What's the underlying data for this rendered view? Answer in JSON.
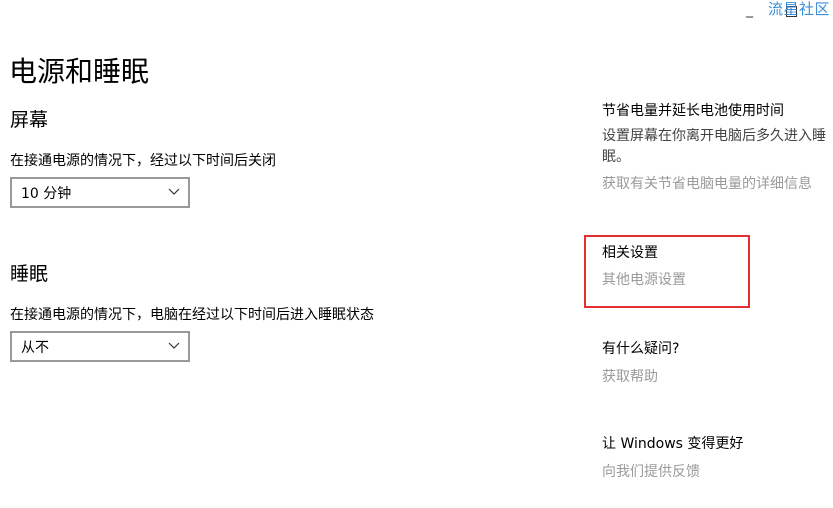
{
  "watermark": "流星社区",
  "window": {
    "minimize_icon": "minimize-icon",
    "maximize_icon": "maximize-icon"
  },
  "page": {
    "title": "电源和睡眠"
  },
  "screen": {
    "title": "屏幕",
    "label": "在接通电源的情况下，经过以下时间后关闭",
    "value": "10 分钟"
  },
  "sleep": {
    "title": "睡眠",
    "label": "在接通电源的情况下，电脑在经过以下时间后进入睡眠状态",
    "value": "从不"
  },
  "sidebar": {
    "power_saving": {
      "heading": "节省电量并延长电池使用时间",
      "body": "设置屏幕在你离开电脑后多久进入睡眠。",
      "link": "获取有关节省电脑电量的详细信息"
    },
    "related": {
      "heading": "相关设置",
      "link": "其他电源设置"
    },
    "question": {
      "heading": "有什么疑问?",
      "link": "获取帮助"
    },
    "better": {
      "heading": "让 Windows 变得更好",
      "link": "向我们提供反馈"
    }
  },
  "colors": {
    "highlight": "#e03030",
    "link_gray": "#9a9a9a",
    "watermark": "#3a8fd8"
  }
}
